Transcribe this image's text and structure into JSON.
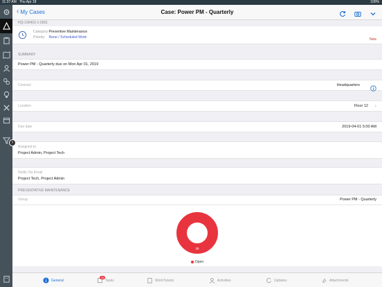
{
  "statusbar": {
    "time": "11:37 AM",
    "date": "Thu Apr 18",
    "battery": "100%"
  },
  "header": {
    "back_label": "My Cases",
    "title": "Case: Power PM - Quarterly"
  },
  "case": {
    "id": "HQ-190402-1-0001",
    "category_label": "Category:",
    "category_value": "Preventive Maintenance",
    "priority_label": "Priority:",
    "priority_value": "None / Scheduled Work",
    "status": "New"
  },
  "summary": {
    "section": "Summary",
    "text": "Power PM - Quarterly due on Mon Apr 01, 2019"
  },
  "contract": {
    "label": "Contract",
    "value": "Headquarters"
  },
  "location": {
    "label": "Location",
    "value": "Floor 12"
  },
  "due": {
    "label": "Due date",
    "value": "2019-04-01 5:00 AM"
  },
  "assigned": {
    "label": "Assigned to",
    "value": "Project Admin, Project Tech"
  },
  "notify": {
    "label": "Notify Via Email",
    "value": "Project Tech, Project Admin"
  },
  "pm": {
    "section": "Preventative Maintenance",
    "group_label": "Group",
    "group_value": "Power PM - Quarterly"
  },
  "chart_data": {
    "type": "pie",
    "categories": [
      "Open"
    ],
    "values": [
      35
    ],
    "legend": "bottom",
    "colors": [
      "#e8343e"
    ]
  },
  "tabs": [
    {
      "label": "General"
    },
    {
      "label": "Tasks",
      "badge": "35"
    },
    {
      "label": "WorkTickets"
    },
    {
      "label": "Activities"
    },
    {
      "label": "Updates"
    },
    {
      "label": "Attachments"
    }
  ],
  "colors": {
    "accent": "#1a6fd6",
    "sidebar": "#46525a",
    "chart": "#e8343e",
    "new": "#c0392b"
  }
}
